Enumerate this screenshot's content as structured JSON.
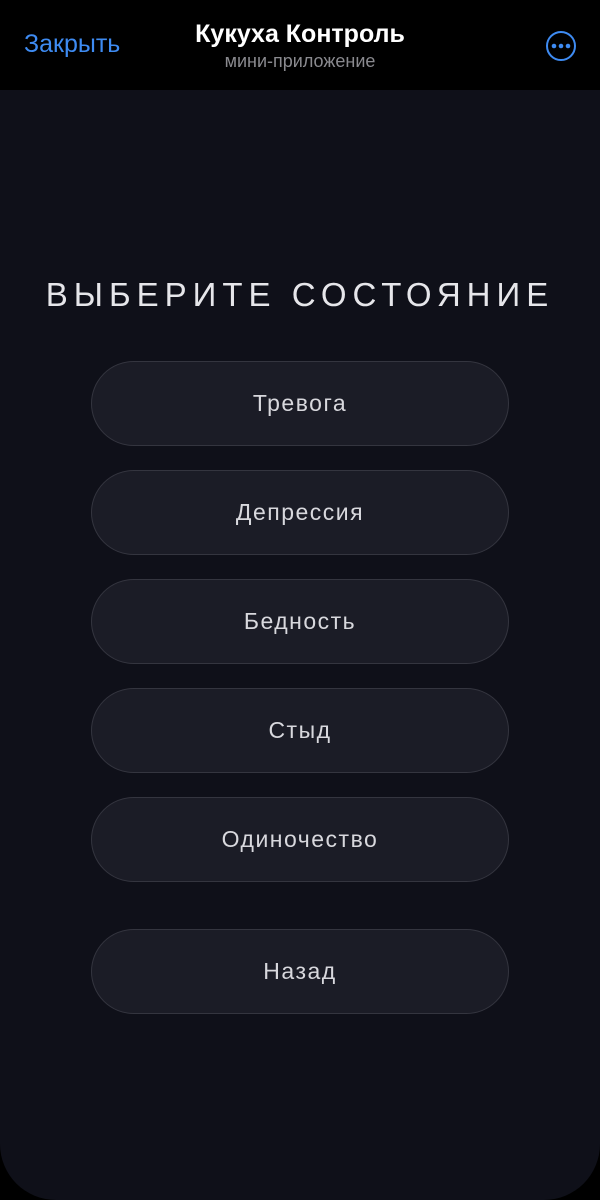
{
  "header": {
    "close_label": "Закрыть",
    "title": "Кукуха Контроль",
    "subtitle": "мини-приложение",
    "more_icon": "more-dots-icon"
  },
  "main": {
    "heading": "ВЫБЕРИТЕ СОСТОЯНИЕ",
    "states": [
      {
        "label": "Тревога"
      },
      {
        "label": "Депрессия"
      },
      {
        "label": "Бедность"
      },
      {
        "label": "Стыд"
      },
      {
        "label": "Одиночество"
      }
    ],
    "back_label": "Назад"
  },
  "colors": {
    "accent": "#3e8bf2",
    "background": "#0f1019",
    "button_fill": "#1b1c26",
    "button_border": "#34353f",
    "text": "#e6e6ea"
  }
}
